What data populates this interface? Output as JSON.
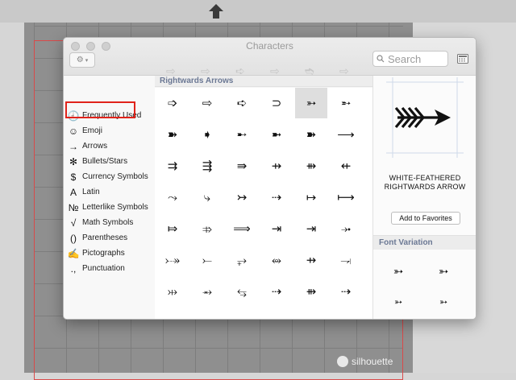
{
  "window": {
    "title": "Characters"
  },
  "toolbar": {
    "search_placeholder": "Search"
  },
  "sidebar": {
    "items": [
      {
        "glyph": "🕘",
        "label": "Frequently Used"
      },
      {
        "glyph": "☺",
        "label": "Emoji"
      },
      {
        "glyph": "→",
        "label": "Arrows"
      },
      {
        "glyph": "✻",
        "label": "Bullets/Stars"
      },
      {
        "glyph": "$",
        "label": "Currency Symbols"
      },
      {
        "glyph": "A",
        "label": "Latin"
      },
      {
        "glyph": "№",
        "label": "Letterlike Symbols"
      },
      {
        "glyph": "√",
        "label": "Math Symbols"
      },
      {
        "glyph": "()",
        "label": "Parentheses"
      },
      {
        "glyph": "✍",
        "label": "Pictographs"
      },
      {
        "glyph": ".,",
        "label": "Punctuation"
      }
    ]
  },
  "grid": {
    "faded": [
      "⇨",
      "⇨",
      "➪",
      "⇨",
      "➬",
      "⇨"
    ],
    "section_title": "Rightwards Arrows",
    "rows": [
      [
        "➩",
        "⇨",
        "➪",
        "⊃",
        "➳",
        "➵"
      ],
      [
        "➽",
        "➧",
        "➸",
        "➼",
        "➽",
        "⟶"
      ],
      [
        "⇉",
        "⇶",
        "⇛",
        "⇸",
        "⇻",
        "⇷"
      ],
      [
        "⤳",
        "⤷",
        "↣",
        "⇢",
        "↦",
        "⟼"
      ],
      [
        "⤇",
        "⤃",
        "⟹",
        "⇥",
        "⇥",
        "⤞"
      ],
      [
        "⤐",
        "⤚",
        "⥅",
        "⥈",
        "⇸",
        "⥗"
      ],
      [
        "⤔",
        "⥇",
        "⥃",
        "⇢",
        "⇻",
        "⇢"
      ]
    ],
    "selected_index": [
      0,
      4
    ]
  },
  "detail": {
    "preview_glyph": "➳",
    "char_name": "WHITE-FEATHERED RIGHTWARDS ARROW",
    "favorites_button": "Add to Favorites",
    "font_variation_title": "Font Variation",
    "variations": [
      "➳",
      "➳",
      "➳",
      "➳"
    ]
  },
  "background": {
    "brand": "silhouette"
  },
  "colors": {
    "highlight": "#e0231b",
    "section_header_text": "#6b7894"
  }
}
